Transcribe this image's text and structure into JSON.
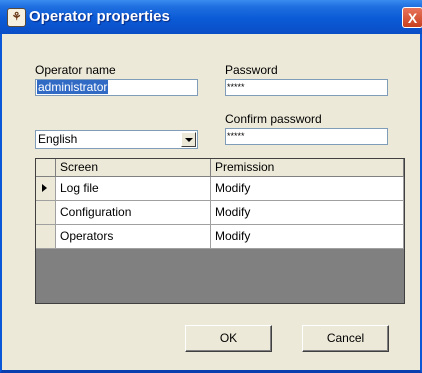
{
  "window": {
    "title": "Operator properties",
    "close_glyph": "X",
    "icon": "app-icon"
  },
  "form": {
    "operator_name_label": "Operator name",
    "operator_name_value": "administrator",
    "password_label": "Password",
    "password_value": "*****",
    "confirm_password_label": "Confirm password",
    "confirm_password_value": "*****",
    "language_value": "English"
  },
  "grid": {
    "columns": [
      "Screen",
      "Premission"
    ],
    "rows": [
      {
        "screen": "Log file",
        "permission": "Modify"
      },
      {
        "screen": "Configuration",
        "permission": "Modify"
      },
      {
        "screen": "Operators",
        "permission": "Modify"
      }
    ]
  },
  "buttons": {
    "ok": "OK",
    "cancel": "Cancel"
  }
}
